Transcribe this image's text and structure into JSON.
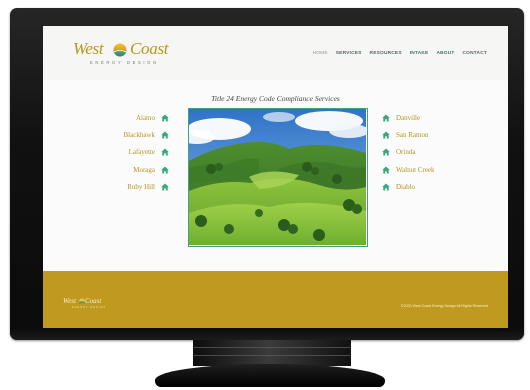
{
  "brand": {
    "word1": "West",
    "word2": "Coast",
    "tagline": "ENERGY DESIGN",
    "accent_color": "#b8971c"
  },
  "nav": {
    "items": [
      "HOME",
      "SERVICES",
      "RESOURCES",
      "INTAKE",
      "ABOUT",
      "CONTACT"
    ],
    "current": "HOME"
  },
  "main": {
    "title": "Title 24 Energy Code Compliance Services",
    "cities_left": [
      "Alamo",
      "Blackhawk",
      "Lafayette",
      "Moraga",
      "Ruby Hill"
    ],
    "cities_right": [
      "Danville",
      "San Ramon",
      "Orinda",
      "Walnut Creek",
      "Diablo"
    ],
    "city_icon": "home-icon",
    "icon_color": "#3aa77d",
    "photo": "green-hills-landscape"
  },
  "footer": {
    "brand_word1": "West",
    "brand_word2": "Coast",
    "brand_tagline": "ENERGY DESIGN",
    "copyright": "©2020 West Coast Energy Design All Rights Reserved",
    "background": "#c09a1e"
  }
}
